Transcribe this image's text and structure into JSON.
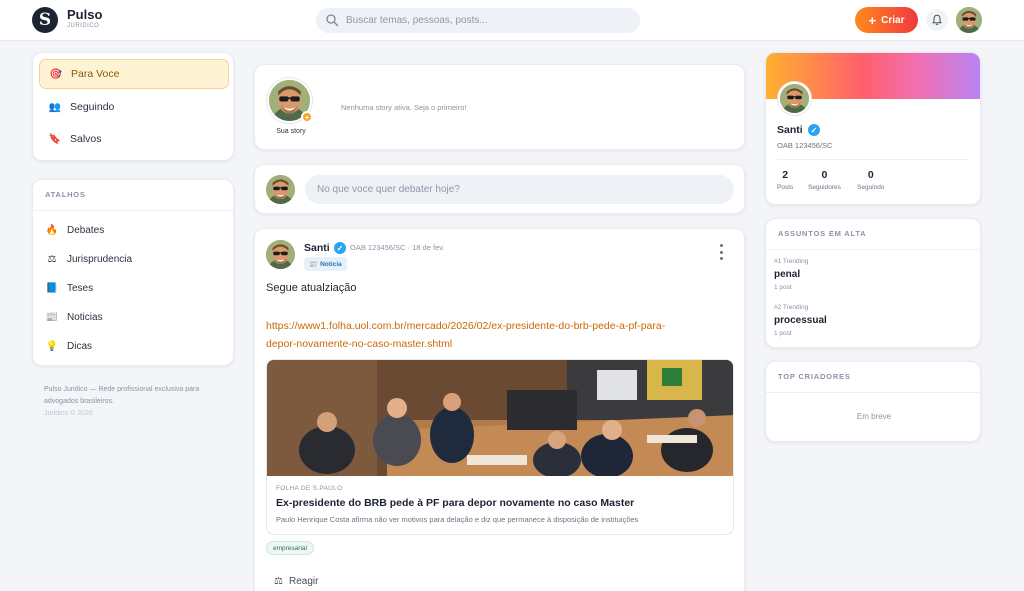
{
  "header": {
    "brand_name": "Pulso",
    "brand_sub": "JURIDICO",
    "logo_letter": "S",
    "search_placeholder": "Buscar temas, pessoas, posts...",
    "create_label": "Criar",
    "create_icon": "+"
  },
  "nav": {
    "items": [
      {
        "label": "Para Voce",
        "icon": "dartboard-icon",
        "glyph": "🎯",
        "active": true
      },
      {
        "label": "Seguindo",
        "icon": "people-icon",
        "glyph": "👥",
        "active": false
      },
      {
        "label": "Salvos",
        "icon": "bookmark-icon",
        "glyph": "🔖",
        "active": false
      }
    ]
  },
  "shortcuts": {
    "title": "ATALHOS",
    "items": [
      {
        "label": "Debates",
        "icon": "fire-icon",
        "glyph": "🔥"
      },
      {
        "label": "Jurisprudencia",
        "icon": "scales-icon",
        "glyph": "⚖"
      },
      {
        "label": "Teses",
        "icon": "book-icon",
        "glyph": "📘"
      },
      {
        "label": "Noticias",
        "icon": "newspaper-icon",
        "glyph": "📰"
      },
      {
        "label": "Dicas",
        "icon": "lightbulb-icon",
        "glyph": "💡"
      }
    ]
  },
  "footer": {
    "text": "Pulso Juridico — Rede profissional exclusiva para advogados brasileiros.",
    "copyright": "Juridico © 2026"
  },
  "stories": {
    "my_label": "Sua story",
    "plus": "+",
    "empty_text": "Nenhuma story ativa. Seja o primeiro!"
  },
  "composer": {
    "placeholder": "No que voce quer debater hoje?"
  },
  "post": {
    "author": "Santi",
    "verified_mark": "✓",
    "oab": "OAB 123456/SC",
    "date": "· 18 de fev.",
    "category_glyph": "📰",
    "category": "Noticia",
    "text": "Segue atualziação",
    "link_line1": "https://www1.folha.uol.com.br/mercado/2026/02/ex-presidente-do-brb-pede-a-pf-para-",
    "link_line2": "depor-novamente-no-caso-master.shtml",
    "preview": {
      "source": "FOLHA DE S.PAULO",
      "title": "Ex-presidente do BRB pede à PF para depor novamente no caso Master",
      "description": "Paulo Henrique Costa afirma não ver motivos para delação e diz que permanece à disposição de instituições"
    },
    "hashtag": "empresarial",
    "react_label": "Reagir",
    "react_glyph": "⚖"
  },
  "profile": {
    "name": "Santi",
    "oab": "OAB 123456/SC",
    "stats": [
      {
        "value": "2",
        "label": "Posts"
      },
      {
        "value": "0",
        "label": "Seguidores"
      },
      {
        "value": "0",
        "label": "Seguindo"
      }
    ]
  },
  "trending": {
    "title": "ASSUNTOS EM ALTA",
    "items": [
      {
        "rank": "#1 Trending",
        "name": "penal",
        "count": "1 post"
      },
      {
        "rank": "#2 Trending",
        "name": "processual",
        "count": "1 post"
      }
    ]
  },
  "creators": {
    "title": "TOP CRIADORES",
    "empty": "Em breve"
  },
  "colors": {
    "accent_orange": "#ff8a1c",
    "accent_red": "#f0383f",
    "link": "#c86a05",
    "verified": "#2aa3f0"
  }
}
